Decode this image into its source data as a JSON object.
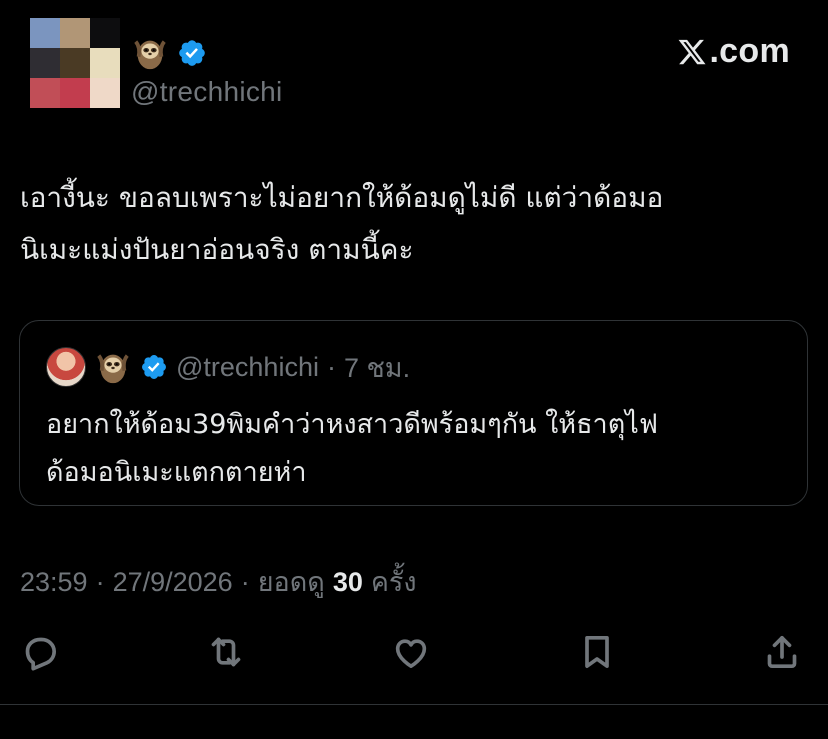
{
  "tweet": {
    "handle": "@trechhichi",
    "brand": "X.com",
    "brand_suffix": ".com",
    "text": "เอางี้นะ ขอลบเพราะไม่อยากให้ด้อมดูไม่ดี แต่ว่าด้อมอ\nนิเมะแม่งปันยาอ่อนจริง ตามนี้คะ",
    "quote": {
      "handle": "@trechhichi",
      "separator": "·",
      "time": "7 ชม.",
      "text": "อยากให้ด้อม39พิมคำว่าหงสาวดีพร้อมๆกัน ให้ธาตุไฟ\nด้อมอนิเมะแตกตายห่า"
    },
    "meta": {
      "time": "23:59",
      "sep1": "·",
      "date": "27/9/2026",
      "sep2": "·",
      "views_label": "ยอดดู",
      "views_count": "30",
      "views_unit": "ครั้ง"
    }
  },
  "icons": {
    "verified": "verified-badge-icon",
    "emoji": "sloth-emoji",
    "actions": [
      "reply-icon",
      "retweet-icon",
      "like-icon",
      "bookmark-icon",
      "share-icon"
    ]
  },
  "colors": {
    "background": "#000000",
    "text": "#e7e9ea",
    "secondary": "#71767b",
    "verified": "#1d9bf0",
    "border": "#2f3336"
  }
}
